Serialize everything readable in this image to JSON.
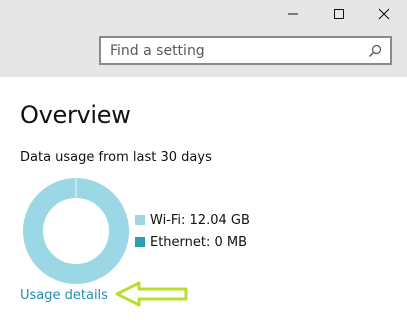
{
  "window": {
    "controls": {
      "minimize": "minimize-icon",
      "maximize": "maximize-icon",
      "close": "close-icon"
    }
  },
  "search": {
    "placeholder": "Find a setting",
    "icon": "search-icon"
  },
  "page": {
    "title": "Overview",
    "subtitle": "Data usage from last 30 days"
  },
  "chart_data": {
    "type": "pie",
    "title": "",
    "series": [
      {
        "name": "Wi-Fi",
        "label": "Wi-Fi: 12.04 GB",
        "value_gb": 12.04,
        "color": "#9bd7e5"
      },
      {
        "name": "Ethernet",
        "label": "Ethernet: 0 MB",
        "value_gb": 0,
        "color": "#2d9cb6"
      }
    ],
    "legend_placement": "right"
  },
  "links": {
    "usage_details": "Usage details"
  },
  "annotation": {
    "arrow_color": "#b8e02a"
  },
  "colors": {
    "header_bg": "#e6e6e6",
    "link": "#1e8fb0",
    "wifi": "#9bd7e5",
    "ethernet": "#2d9cb6"
  }
}
